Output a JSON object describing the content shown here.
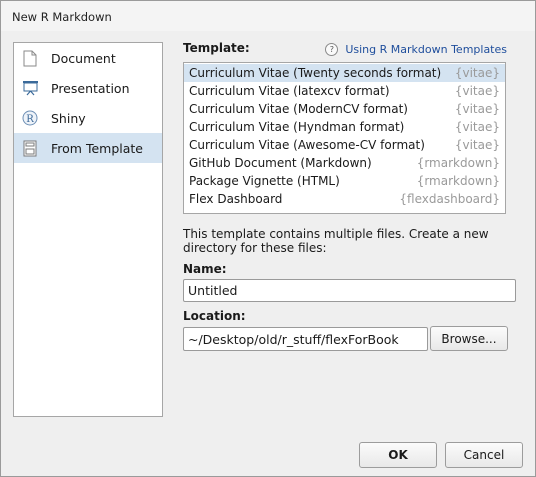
{
  "window": {
    "title": "New R Markdown"
  },
  "sidebar": {
    "items": [
      {
        "label": "Document",
        "icon": "document-icon",
        "selected": false
      },
      {
        "label": "Presentation",
        "icon": "presentation-icon",
        "selected": false
      },
      {
        "label": "Shiny",
        "icon": "shiny-icon",
        "selected": false
      },
      {
        "label": "From Template",
        "icon": "template-icon",
        "selected": true
      }
    ]
  },
  "main": {
    "template_label": "Template:",
    "help_link": "Using R Markdown Templates",
    "help_glyph": "?",
    "templates": [
      {
        "name": "Curriculum Vitae (Twenty seconds format)",
        "package": "{vitae}",
        "selected": true
      },
      {
        "name": "Curriculum Vitae (latexcv format)",
        "package": "{vitae}",
        "selected": false
      },
      {
        "name": "Curriculum Vitae (ModernCV format)",
        "package": "{vitae}",
        "selected": false
      },
      {
        "name": "Curriculum Vitae (Hyndman format)",
        "package": "{vitae}",
        "selected": false
      },
      {
        "name": "Curriculum Vitae (Awesome-CV format)",
        "package": "{vitae}",
        "selected": false
      },
      {
        "name": "GitHub Document (Markdown)",
        "package": "{rmarkdown}",
        "selected": false
      },
      {
        "name": "Package Vignette (HTML)",
        "package": "{rmarkdown}",
        "selected": false
      },
      {
        "name": "Flex Dashboard",
        "package": "{flexdashboard}",
        "selected": false
      }
    ],
    "description": "This template contains multiple files. Create a new directory for these files:",
    "name_label": "Name:",
    "name_value": "Untitled",
    "location_label": "Location:",
    "location_value": "~/Desktop/old/r_stuff/flexForBook",
    "browse_label": "Browse..."
  },
  "footer": {
    "ok_label": "OK",
    "cancel_label": "Cancel"
  },
  "colors": {
    "selection": "#d4e3f1",
    "link": "#1f4e9c",
    "package_text": "#9a9a9a"
  }
}
